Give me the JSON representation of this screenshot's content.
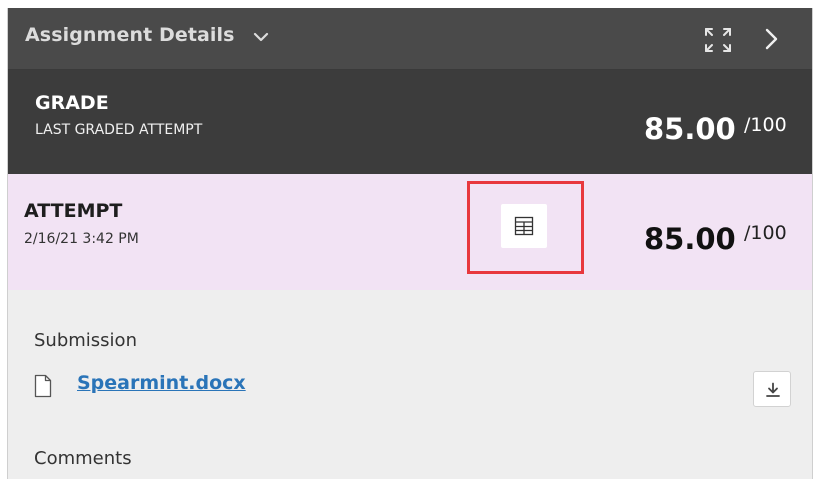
{
  "header": {
    "title": "Assignment Details",
    "dropdown_icon": "chevron-down-icon",
    "expand_icon": "expand-icon",
    "next_icon": "chevron-right-icon"
  },
  "grade": {
    "label": "GRADE",
    "sublabel": "LAST GRADED ATTEMPT",
    "score": "85.00",
    "max": "/100"
  },
  "attempt": {
    "label": "ATTEMPT",
    "date": "2/16/21 3:42 PM",
    "rubric_icon": "rubric-grid-icon",
    "score": "85.00",
    "max": "/100"
  },
  "submission": {
    "label": "Submission",
    "file_icon": "document-icon",
    "file_name": "Spearmint.docx",
    "download_icon": "download-icon"
  },
  "comments": {
    "label": "Comments"
  },
  "colors": {
    "header_bg": "#4a4a4a",
    "grade_bg": "#3c3c3c",
    "attempt_bg": "#f2e3f4",
    "body_bg": "#eeeeee",
    "link": "#2a74b8",
    "highlight": "#e8383d"
  }
}
